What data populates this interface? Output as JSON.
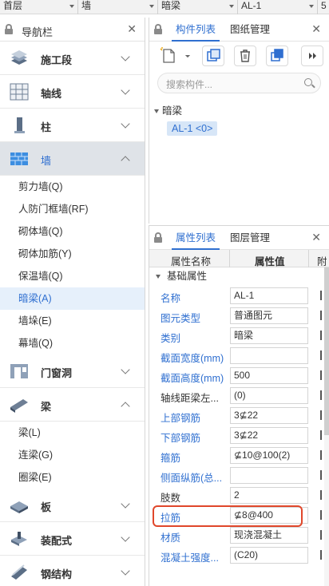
{
  "topbar": {
    "floor": "首层",
    "category": "墙",
    "type": "暗梁",
    "name": "AL-1",
    "extra": "5"
  },
  "nav": {
    "title": "导航栏",
    "groups": [
      {
        "label": "施工段",
        "icon": "construction-stage-icon"
      },
      {
        "label": "轴线",
        "icon": "grid-axis-icon"
      },
      {
        "label": "柱",
        "icon": "column-icon"
      },
      {
        "label": "墙",
        "icon": "wall-icon"
      },
      {
        "label": "门窗洞",
        "icon": "door-window-icon"
      },
      {
        "label": "梁",
        "icon": "beam-icon"
      },
      {
        "label": "板",
        "icon": "slab-icon"
      },
      {
        "label": "装配式",
        "icon": "prefab-icon"
      },
      {
        "label": "钢结构",
        "icon": "steel-structure-icon"
      }
    ],
    "wall_items": [
      "剪力墙(Q)",
      "人防门框墙(RF)",
      "砌体墙(Q)",
      "砌体加筋(Y)",
      "保温墙(Q)",
      "暗梁(A)",
      "墙垛(E)",
      "幕墙(Q)"
    ],
    "beam_items": [
      "梁(L)",
      "连梁(G)",
      "圈梁(E)"
    ]
  },
  "components": {
    "tab_list": "构件列表",
    "tab_drawings": "图纸管理",
    "search_placeholder": "搜索构件...",
    "tree_root": "暗梁",
    "tree_item": "AL-1 <0>"
  },
  "properties": {
    "tab_props": "属性列表",
    "tab_layers": "图层管理",
    "col_name": "属性名称",
    "col_value": "属性值",
    "col_extra": "附",
    "section": "基础属性",
    "rows": [
      {
        "name": "名称",
        "value": "AL-1",
        "blue": true
      },
      {
        "name": "图元类型",
        "value": "普通图元",
        "blue": true
      },
      {
        "name": "类别",
        "value": "暗梁",
        "blue": true
      },
      {
        "name": "截面宽度(mm)",
        "value": "",
        "blue": true
      },
      {
        "name": "截面高度(mm)",
        "value": "500",
        "blue": true
      },
      {
        "name": "轴线距梁左...",
        "value": "(0)",
        "blue": false
      },
      {
        "name": "上部钢筋",
        "value": "3⊈22",
        "blue": true
      },
      {
        "name": "下部钢筋",
        "value": "3⊈22",
        "blue": true
      },
      {
        "name": "箍筋",
        "value": "⊈10@100(2)",
        "blue": true
      },
      {
        "name": "侧面纵筋(总...",
        "value": "",
        "blue": true
      },
      {
        "name": "肢数",
        "value": "2",
        "blue": false
      },
      {
        "name": "拉筋",
        "value": "⊈8@400",
        "blue": true
      },
      {
        "name": "材质",
        "value": "现浇混凝土",
        "blue": true
      },
      {
        "name": "混凝土强度...",
        "value": "(C20)",
        "blue": true
      }
    ]
  },
  "colors": {
    "accent": "#2f6fd0",
    "highlight": "#e0472b",
    "active_group": "#dfe3e8"
  }
}
